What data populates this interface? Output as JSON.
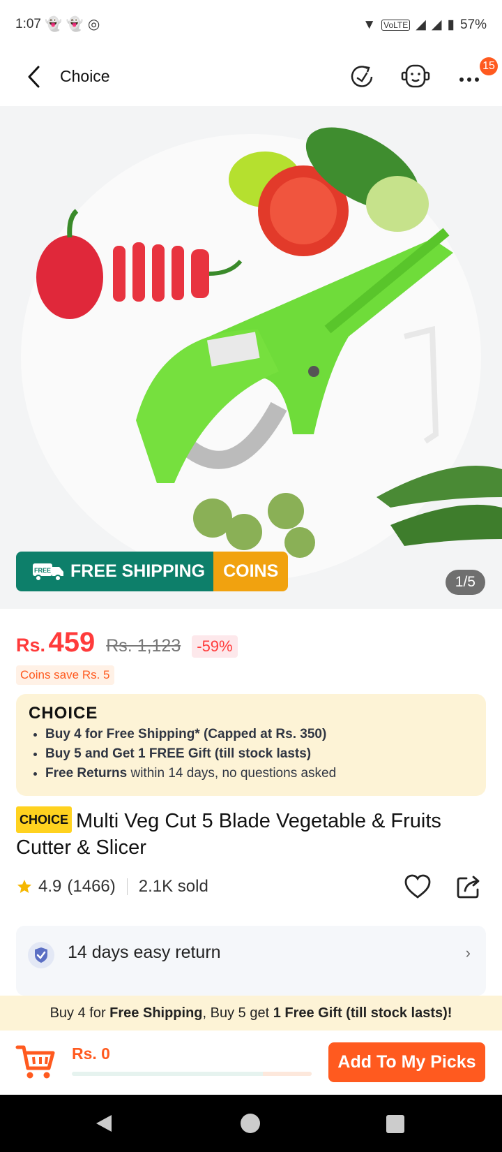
{
  "status": {
    "time": "1:07",
    "battery": "57%",
    "network": "VoLTE"
  },
  "nav": {
    "title": "Choice",
    "badge": "15"
  },
  "hero": {
    "shipping": "FREE SHIPPING",
    "free_tag": "FREE",
    "coins": "COINS",
    "pager": "1/5"
  },
  "price": {
    "currency": "Rs.",
    "value": "459",
    "original": "Rs. 1,123",
    "discount": "-59%",
    "coins_save": "Coins save Rs. 5"
  },
  "choice": {
    "logo": "CHOICE",
    "benefits": [
      {
        "bold": "Buy 4 for  Free Shipping* (Capped at Rs. 350)",
        "rest": ""
      },
      {
        "bold": "Buy 5 and Get 1 FREE Gift (till stock lasts)",
        "rest": ""
      },
      {
        "bold": "Free Returns",
        "rest": " within 14 days, no questions asked"
      }
    ]
  },
  "product": {
    "tag": "CHOICE",
    "title": "Multi Veg Cut 5 Blade Vegetable & Fruits Cutter & Slicer",
    "rating": "4.9",
    "reviews": "(1466)",
    "sold": "2.1K sold"
  },
  "service": {
    "return": "14 days easy return"
  },
  "promo": {
    "p1": "Buy 4 for ",
    "p2": "Free Shipping",
    "p3": ", Buy 5 get ",
    "p4": "1 Free Gift (till stock lasts)!"
  },
  "bottom": {
    "total": "Rs. 0",
    "button": "Add To My Picks",
    "progress": 0.0
  },
  "colors": {
    "accent": "#ff5a1f",
    "price_red": "#ff3b3b",
    "free_ship_green": "#0d7f6a",
    "coins_orange": "#f1a20f",
    "choice_yellow": "#fdf3d6"
  }
}
